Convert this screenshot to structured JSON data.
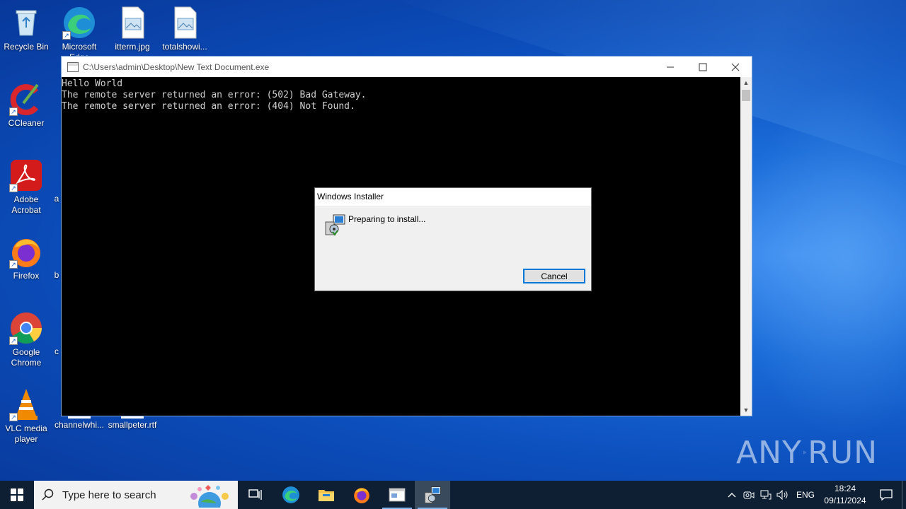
{
  "desktop": {
    "icons": [
      {
        "label": "Recycle Bin",
        "icon": "recycle-bin-icon"
      },
      {
        "label": "Microsoft Edge",
        "icon": "edge-icon"
      },
      {
        "label": "itterm.jpg",
        "icon": "image-file-icon"
      },
      {
        "label": "totalshowi...",
        "icon": "image-file-icon"
      },
      {
        "label": "CCleaner",
        "icon": "ccleaner-icon"
      },
      {
        "label": "Adobe Acrobat",
        "icon": "acrobat-icon"
      },
      {
        "label": "Firefox",
        "icon": "firefox-icon"
      },
      {
        "label": "Google Chrome",
        "icon": "chrome-icon"
      },
      {
        "label": "VLC media player",
        "icon": "vlc-icon"
      },
      {
        "label": "channelwhi...",
        "icon": "file-icon"
      },
      {
        "label": "smallpeter.rtf",
        "icon": "file-icon"
      }
    ],
    "partial_labels": [
      "a",
      "b",
      "c"
    ]
  },
  "console": {
    "title": "C:\\Users\\admin\\Desktop\\New Text Document.exe",
    "lines": [
      "Hello World",
      "The remote server returned an error: (502) Bad Gateway.",
      "The remote server returned an error: (404) Not Found."
    ]
  },
  "installer": {
    "title": "Windows Installer",
    "message": "Preparing to install...",
    "cancel_label": "Cancel"
  },
  "watermark": {
    "text_left": "ANY",
    "text_right": "RUN"
  },
  "taskbar": {
    "search_placeholder": "Type here to search",
    "apps": [
      "task-view-icon",
      "edge-icon",
      "file-explorer-icon",
      "firefox-icon",
      "console-app-icon",
      "installer-app-icon"
    ],
    "language": "ENG",
    "time": "18:24",
    "date": "09/11/2024"
  },
  "colors": {
    "taskbar_bg": "#0f1f33",
    "accent": "#0078d7",
    "desktop_blue": "#1a6bd8"
  }
}
